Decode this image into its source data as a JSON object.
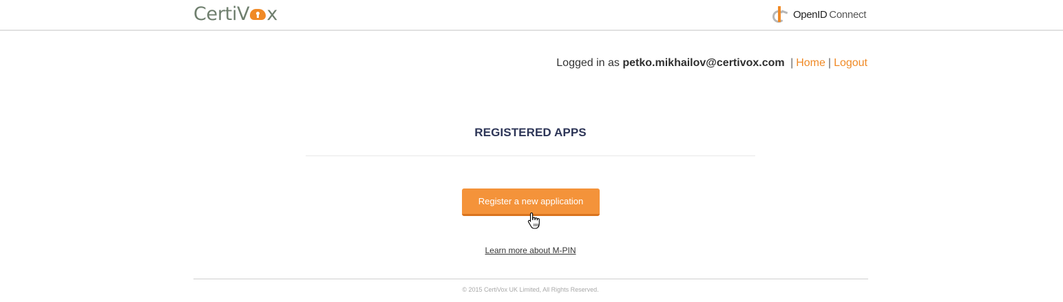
{
  "header": {
    "logo_text_a": "CertiV",
    "logo_text_b": "x",
    "openid_text_a": "OpenID",
    "openid_text_b": "Connect"
  },
  "userbar": {
    "prefix": "Logged in as",
    "email": "petko.mikhailov@certivox.com",
    "separator": "|",
    "home_label": "Home",
    "logout_label": "Logout"
  },
  "main": {
    "title": "REGISTERED APPS",
    "register_button_label": "Register a new application",
    "learn_more_label": "Learn more about M-PIN"
  },
  "footer": {
    "copyright": "© 2015 CertiVox UK Limited, All Rights Reserved."
  },
  "colors": {
    "accent": "#f08a26",
    "button": "#f4933a",
    "title": "#2d3557",
    "logo_text": "#6f7f6e"
  },
  "icons": {
    "logo_lock": "cloud-lock-icon",
    "openid_mark": "openid-logo-icon",
    "cursor": "hand-pointer-cursor"
  }
}
